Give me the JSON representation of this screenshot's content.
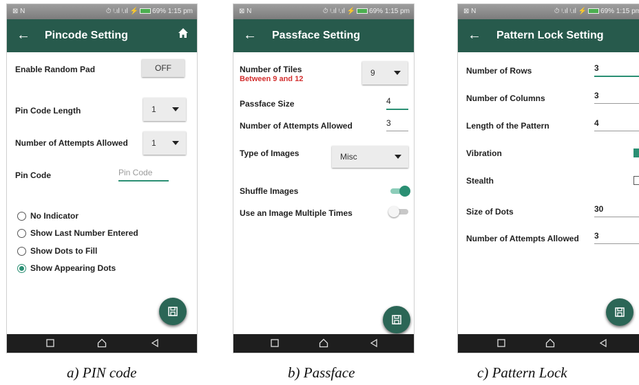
{
  "status_bar": {
    "left": "⊠ N",
    "right_prefix": "⏱ ᵎ.ıl ᵎ.ıl ⚡",
    "battery": "69%",
    "time": "1:15 pm"
  },
  "screens": {
    "pin": {
      "title": "Pincode Setting",
      "random_pad_label": "Enable Random Pad",
      "random_pad_value": "OFF",
      "pin_length_label": "Pin Code Length",
      "pin_length_value": "1",
      "attempts_label": "Number of Attempts Allowed",
      "attempts_value": "1",
      "pin_code_label": "Pin Code",
      "pin_code_placeholder": "Pin Code",
      "options": [
        "No Indicator",
        "Show Last Number Entered",
        "Show Dots to Fill",
        "Show Appearing Dots"
      ],
      "selected_option": 3,
      "caption": "a) PIN code"
    },
    "passface": {
      "title": "Passface Setting",
      "tiles_label": "Number of Tiles",
      "tiles_hint": "Between 9 and 12",
      "tiles_value": "9",
      "size_label": "Passface Size",
      "size_value": "4",
      "attempts_label": "Number of Attempts Allowed",
      "attempts_value": "3",
      "images_label": "Type of Images",
      "images_value": "Misc",
      "shuffle_label": "Shuffle Images",
      "shuffle_on": true,
      "multiple_label": "Use an Image Multiple Times",
      "multiple_on": false,
      "caption": "b) Passface"
    },
    "pattern": {
      "title": "Pattern Lock Setting",
      "rows_label": "Number of Rows",
      "rows_value": "3",
      "cols_label": "Number of Columns",
      "cols_value": "3",
      "length_label": "Length of the Pattern",
      "length_value": "4",
      "vibration_label": "Vibration",
      "vibration_on": true,
      "stealth_label": "Stealth",
      "stealth_on": false,
      "dots_label": "Size of Dots",
      "dots_value": "30",
      "attempts_label": "Number of Attempts Allowed",
      "attempts_value": "3",
      "caption": "c) Pattern Lock"
    }
  },
  "icons": {
    "back": "arrow-back-icon",
    "home": "home-icon",
    "save": "save-icon",
    "nav": [
      "square-icon",
      "home-outline-icon",
      "triangle-back-icon"
    ]
  },
  "colors": {
    "app_bar": "#275a4c",
    "accent": "#2a8f73",
    "hint_red": "#d32f2f",
    "fab": "#2b6656"
  }
}
